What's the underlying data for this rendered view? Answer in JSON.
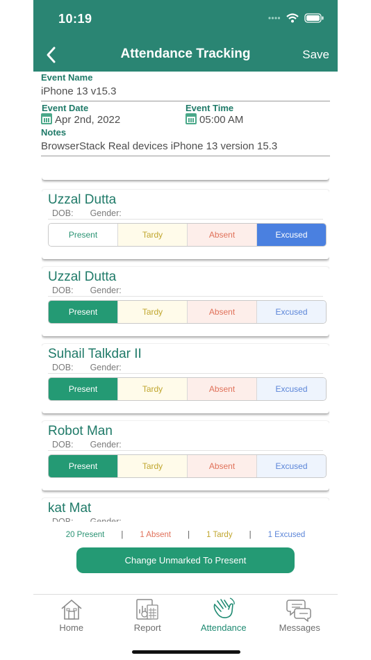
{
  "status": {
    "time": "10:19"
  },
  "nav": {
    "title": "Attendance Tracking",
    "save": "Save"
  },
  "form": {
    "event_name_label": "Event Name",
    "event_name": "iPhone 13 v15.3",
    "event_date_label": "Event Date",
    "event_date": "Apr 2nd, 2022",
    "event_time_label": "Event Time",
    "event_time": "05:00 AM",
    "notes_label": "Notes",
    "notes": "BrowserStack Real devices iPhone 13 version 15.3"
  },
  "options": {
    "present": "Present",
    "tardy": "Tardy",
    "absent": "Absent",
    "excused": "Excused"
  },
  "dob_label": "DOB:",
  "gender_label": "Gender:",
  "students": [
    {
      "name": "Uzzal Dutta",
      "status": "excused"
    },
    {
      "name": "Uzzal Dutta",
      "status": "present"
    },
    {
      "name": "Suhail Talkdar II",
      "status": "present"
    },
    {
      "name": "Robot Man",
      "status": "present"
    },
    {
      "name": "kat Mat",
      "status": ""
    }
  ],
  "summary": {
    "present": "20 Present",
    "absent": "1 Absent",
    "tardy": "1 Tardy",
    "excused": "1 Excused",
    "separator": "|"
  },
  "cta": "Change Unmarked To Present",
  "tabs": [
    {
      "label": "Home",
      "icon": "home-icon"
    },
    {
      "label": "Report",
      "icon": "report-icon"
    },
    {
      "label": "Attendance",
      "icon": "attendance-icon",
      "active": true
    },
    {
      "label": "Messages",
      "icon": "messages-icon"
    }
  ],
  "colors": {
    "brand": "#2a8573",
    "present": "#249a74",
    "tardy": "#c0a62e",
    "absent": "#e0715a",
    "excused": "#4a80e0"
  }
}
